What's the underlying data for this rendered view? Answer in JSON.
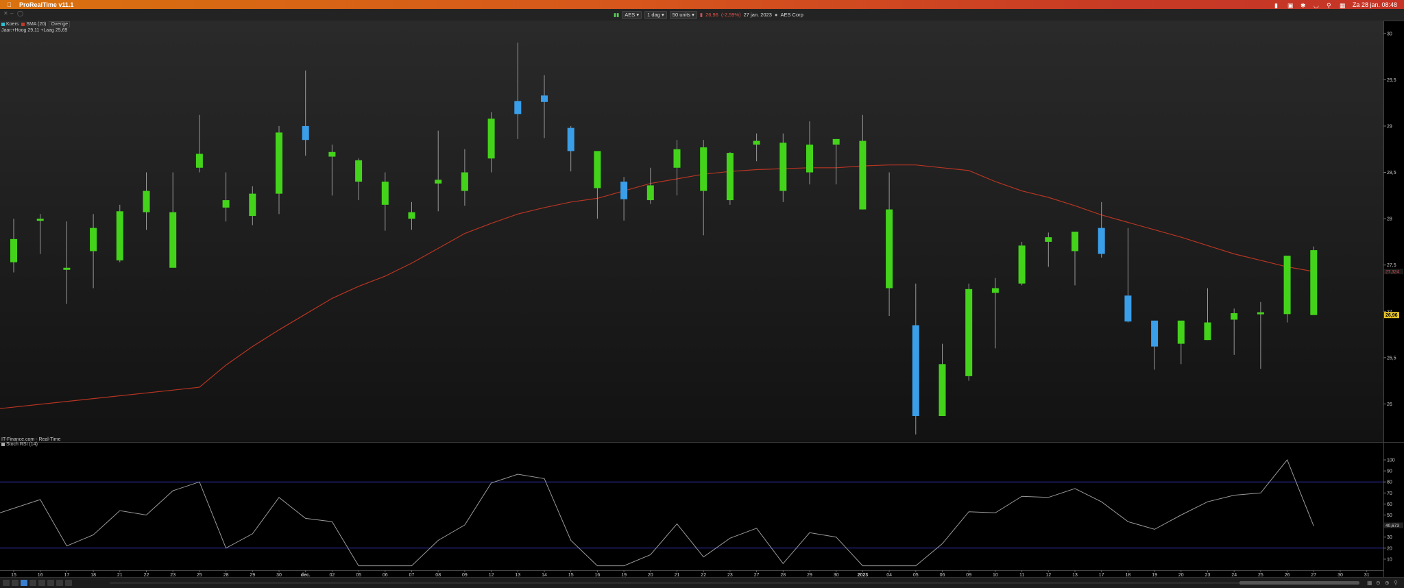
{
  "menubar": {
    "app_title": "ProRealTime v11.1",
    "datetime": "Za 28 jan.  08:48"
  },
  "toolbar": {
    "symbol": "AES",
    "timeframe": "1 dag",
    "units": "50 units",
    "price": "26,96",
    "change": "(-2,59%)",
    "date": "27 jan. 2023",
    "company": "AES Corp"
  },
  "legend": {
    "price": "Koers",
    "sma": "SMA (20)",
    "overige": "Overige",
    "year_range": "Jaar:+Hoog 29,11 +Laag 25,69",
    "vendor": "IT-Finance.com - Real-Time",
    "indicator": "Stoch RSI (14)",
    "price_color": "#2ac0d0",
    "sma_color": "#c0392b"
  },
  "colors": {
    "up": "#44d31b",
    "down": "#3a9ee8",
    "sma": "#b83522",
    "stoch": "#9a9a9a",
    "band": "#3333aa"
  },
  "chart_data": [
    {
      "type": "candlestick",
      "title": "AES",
      "x": [
        "15",
        "16",
        "17",
        "18",
        "21",
        "22",
        "23",
        "25",
        "28",
        "29",
        "30",
        "dec.",
        "02",
        "05",
        "06",
        "07",
        "08",
        "09",
        "12",
        "13",
        "14",
        "15",
        "16",
        "19",
        "20",
        "21",
        "22",
        "23",
        "27",
        "28",
        "29",
        "30",
        "2023",
        "04",
        "05",
        "06",
        "09",
        "10",
        "11",
        "12",
        "13",
        "17",
        "18",
        "19",
        "20",
        "23",
        "24",
        "25",
        "26",
        "27"
      ],
      "open": [
        27.53,
        28.0,
        27.47,
        27.65,
        27.55,
        28.07,
        27.47,
        28.55,
        28.12,
        28.03,
        28.27,
        29.0,
        28.67,
        28.4,
        28.15,
        28.0,
        28.38,
        28.3,
        28.65,
        29.27,
        29.33,
        28.98,
        28.33,
        28.4,
        28.2,
        28.55,
        28.3,
        28.2,
        28.8,
        28.3,
        28.5,
        28.8,
        28.1,
        27.25,
        26.85,
        25.87,
        26.3,
        27.2,
        27.3,
        27.75,
        27.65,
        27.9,
        27.17,
        26.9,
        26.65,
        26.69,
        26.91,
        26.97,
        26.97,
        26.96
      ],
      "high": [
        28.0,
        28.05,
        27.97,
        28.05,
        28.15,
        28.5,
        28.5,
        29.12,
        28.5,
        28.35,
        29.0,
        29.6,
        28.8,
        28.65,
        28.5,
        28.18,
        28.95,
        28.75,
        29.15,
        29.9,
        29.55,
        29.0,
        28.7,
        28.45,
        28.55,
        28.85,
        28.85,
        28.72,
        28.92,
        28.92,
        29.05,
        28.85,
        29.12,
        28.5,
        27.3,
        26.65,
        27.3,
        27.36,
        27.75,
        27.85,
        27.8,
        28.18,
        27.9,
        26.9,
        26.87,
        27.25,
        27.03,
        27.1,
        27.43,
        27.7
      ],
      "high_note": "approx",
      "low": [
        27.42,
        27.62,
        27.08,
        27.25,
        27.53,
        27.88,
        27.88,
        28.5,
        27.97,
        27.93,
        28.05,
        28.68,
        28.25,
        28.2,
        27.87,
        27.88,
        28.08,
        28.14,
        28.5,
        28.86,
        28.87,
        28.51,
        28.0,
        27.98,
        28.16,
        28.25,
        27.82,
        28.15,
        28.62,
        28.18,
        28.37,
        28.37,
        28.1,
        26.95,
        25.67,
        25.87,
        26.25,
        26.6,
        27.28,
        27.48,
        27.28,
        27.58,
        26.88,
        26.37,
        26.43,
        26.69,
        26.53,
        26.38,
        26.88,
        26.96
      ],
      "close": [
        27.78,
        28.0,
        27.47,
        27.9,
        28.08,
        28.3,
        28.07,
        28.7,
        28.2,
        28.27,
        28.93,
        28.85,
        28.72,
        28.63,
        28.4,
        28.07,
        28.42,
        28.5,
        29.08,
        29.13,
        29.26,
        28.73,
        28.73,
        28.21,
        28.36,
        28.75,
        28.77,
        28.71,
        28.84,
        28.82,
        28.8,
        28.86,
        28.84,
        28.1,
        25.87,
        26.43,
        27.24,
        27.25,
        27.71,
        27.8,
        27.86,
        27.62,
        26.89,
        26.62,
        26.9,
        26.88,
        26.98,
        26.99,
        27.6,
        27.66
      ],
      "sma20": [
        25.95,
        26.18,
        26.42,
        26.62,
        26.8,
        26.97,
        27.14,
        27.27,
        27.38,
        27.52,
        27.68,
        27.84,
        27.95,
        28.05,
        28.12,
        28.18,
        28.22,
        28.3,
        28.38,
        28.43,
        28.48,
        28.51,
        28.53,
        28.54,
        28.55,
        28.55,
        28.57,
        28.58,
        28.58,
        28.55,
        28.52,
        28.4,
        28.3,
        28.23,
        28.14,
        28.04,
        27.96,
        27.88,
        27.8,
        27.71,
        27.62,
        27.55,
        27.48,
        27.43
      ],
      "ylim": [
        25.7,
        30.05
      ],
      "y_ticks": [
        "30",
        "29,5",
        "29",
        "28,5",
        "28",
        "27,5",
        "27",
        "26,5",
        "26"
      ],
      "last_price_label": "26,96",
      "sma_label": "27,324"
    },
    {
      "type": "line",
      "title": "Stoch RSI (14)",
      "x": [
        "15",
        "16",
        "17",
        "18",
        "21",
        "22",
        "23",
        "25",
        "28",
        "29",
        "30",
        "dec.",
        "02",
        "05",
        "06",
        "07",
        "08",
        "09",
        "12",
        "13",
        "14",
        "15",
        "16",
        "19",
        "20",
        "21",
        "22",
        "23",
        "27",
        "28",
        "29",
        "30",
        "2023",
        "04",
        "05",
        "06",
        "09",
        "10",
        "11",
        "12",
        "13",
        "17",
        "18",
        "19",
        "20",
        "23",
        "24",
        "25",
        "26",
        "27"
      ],
      "series": [
        {
          "values": [
            52,
            64,
            22,
            32,
            54,
            50,
            72,
            80,
            20,
            33,
            66,
            47,
            44,
            4,
            4,
            4,
            27,
            41,
            79,
            87,
            83,
            27,
            4,
            4,
            14,
            42,
            12,
            29,
            38,
            6,
            34,
            30,
            4,
            4,
            4,
            24,
            53,
            52,
            67,
            66,
            74,
            62,
            44,
            37,
            50,
            62,
            68,
            70,
            100,
            40
          ]
        }
      ],
      "ylim": [
        0,
        105
      ],
      "y_ticks": [
        "100",
        "90",
        "80",
        "70",
        "60",
        "50",
        "40",
        "30",
        "20",
        "10"
      ],
      "bands": [
        80,
        20
      ],
      "last_value_label": "40,673"
    }
  ]
}
